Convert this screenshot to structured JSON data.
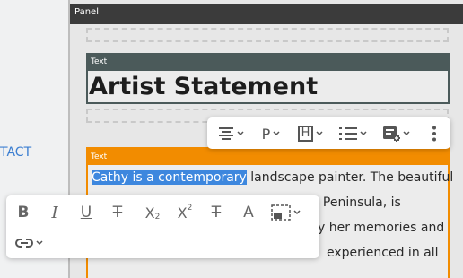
{
  "left": {
    "link": "TACT"
  },
  "panel": {
    "title": "Panel"
  },
  "text_widget_1": {
    "label": "Text",
    "heading": "Artist Statement"
  },
  "text_widget_2": {
    "label": "Text",
    "selected_text": "Cathy is a contemporary",
    "line1_rest": " landscape painter. The beautiful",
    "line2": "on Peninsula, is",
    "line3": "y her memories and",
    "line4": "experienced in all"
  },
  "block_toolbar": {
    "items": [
      {
        "name": "align",
        "icon": "align-center-icon"
      },
      {
        "name": "paragraph",
        "icon": "paragraph-icon",
        "label": "P"
      },
      {
        "name": "heading",
        "icon": "heading-icon",
        "label": "H"
      },
      {
        "name": "list",
        "icon": "list-icon"
      },
      {
        "name": "insert",
        "icon": "insert-block-icon"
      },
      {
        "name": "more",
        "icon": "more-vertical-icon"
      }
    ]
  },
  "format_toolbar": {
    "items": [
      {
        "name": "bold",
        "label": "B"
      },
      {
        "name": "italic",
        "label": "I"
      },
      {
        "name": "underline",
        "label": "U"
      },
      {
        "name": "strikethrough",
        "label": "T"
      },
      {
        "name": "subscript",
        "label": "X",
        "sub": "2"
      },
      {
        "name": "superscript",
        "label": "X",
        "sup": "2"
      },
      {
        "name": "clear-format",
        "label": "T"
      },
      {
        "name": "text-color",
        "label": "A"
      },
      {
        "name": "background",
        "icon": "background-icon"
      },
      {
        "name": "link",
        "icon": "link-icon"
      }
    ]
  }
}
